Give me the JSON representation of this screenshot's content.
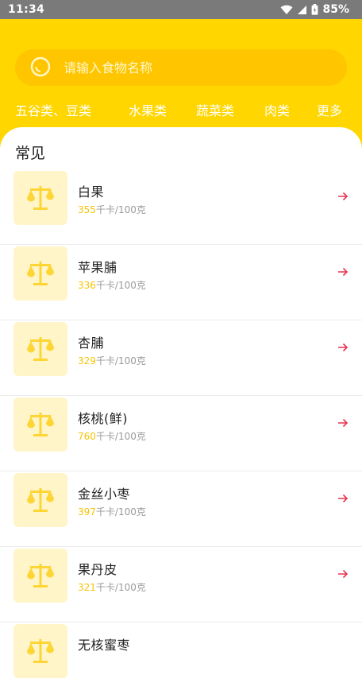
{
  "status_bar": {
    "time": "11:34",
    "battery": "85%"
  },
  "search": {
    "placeholder": "请输入食物名称"
  },
  "categories": [
    {
      "label": "五谷类、豆类"
    },
    {
      "label": "水果类"
    },
    {
      "label": "蔬菜类"
    },
    {
      "label": "肉类"
    },
    {
      "label": "更多"
    }
  ],
  "section": {
    "title": "常见"
  },
  "foods": [
    {
      "name": "白果",
      "kcal": "355",
      "unit": "千卡/100克"
    },
    {
      "name": "苹果脯",
      "kcal": "336",
      "unit": "千卡/100克"
    },
    {
      "name": "杏脯",
      "kcal": "329",
      "unit": "千卡/100克"
    },
    {
      "name": "核桃(鲜)",
      "kcal": "760",
      "unit": "千卡/100克"
    },
    {
      "name": "金丝小枣",
      "kcal": "397",
      "unit": "千卡/100克"
    },
    {
      "name": "果丹皮",
      "kcal": "321",
      "unit": "千卡/100克"
    },
    {
      "name": "无核蜜枣",
      "kcal": "",
      "unit": ""
    }
  ],
  "colors": {
    "header_yellow": "#ffd600",
    "search_bg": "#ffc600",
    "kcal_number": "#f5c400",
    "arrow_red": "#e8344e"
  }
}
